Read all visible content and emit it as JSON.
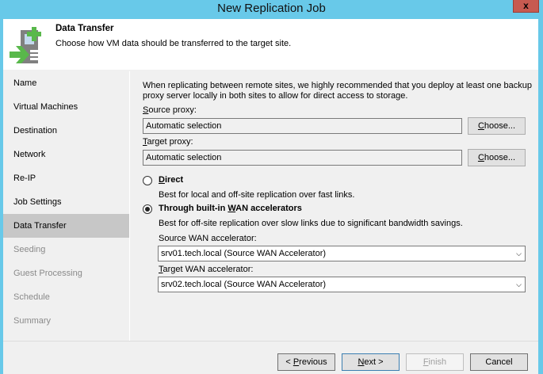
{
  "window": {
    "title": "New Replication Job",
    "close_label": "x"
  },
  "header": {
    "title": "Data Transfer",
    "subtitle": "Choose how VM data should be transferred to the target site."
  },
  "sidebar": {
    "items": [
      {
        "label": "Name",
        "state": "normal"
      },
      {
        "label": "Virtual Machines",
        "state": "normal"
      },
      {
        "label": "Destination",
        "state": "normal"
      },
      {
        "label": "Network",
        "state": "normal"
      },
      {
        "label": "Re-IP",
        "state": "normal"
      },
      {
        "label": "Job Settings",
        "state": "normal"
      },
      {
        "label": "Data Transfer",
        "state": "active"
      },
      {
        "label": "Seeding",
        "state": "disabled"
      },
      {
        "label": "Guest Processing",
        "state": "disabled"
      },
      {
        "label": "Schedule",
        "state": "disabled"
      },
      {
        "label": "Summary",
        "state": "disabled"
      }
    ]
  },
  "main": {
    "info_line1": "When replicating between remote sites, we highly recommended that you deploy at least one backup",
    "info_line2": "proxy server locally in both sites to allow for direct access to storage.",
    "source_proxy": {
      "label_u": "S",
      "label_rest": "ource proxy:",
      "value": "Automatic selection",
      "button_u": "C",
      "button_rest": "hoose..."
    },
    "target_proxy": {
      "label_u": "T",
      "label_rest": "arget proxy:",
      "value": "Automatic selection",
      "button_u": "C",
      "button_rest": "hoose..."
    },
    "direct": {
      "label_u": "D",
      "label_rest": "irect",
      "desc": "Best for local and off-site replication over fast links.",
      "selected": false
    },
    "wan": {
      "label_pre": "Through built-in ",
      "label_u": "W",
      "label_rest": "AN accelerators",
      "desc": "Best for off-site replication over slow links due to significant bandwidth savings.",
      "selected": true
    },
    "source_wan": {
      "label": "Source WAN accelerator:",
      "value": "srv01.tech.local (Source WAN Accelerator)"
    },
    "target_wan": {
      "label_u": "T",
      "label_rest": "arget WAN accelerator:",
      "value": "srv02.tech.local (Source WAN Accelerator)"
    }
  },
  "footer": {
    "previous_pre": "< ",
    "previous_u": "P",
    "previous_rest": "revious",
    "next_u": "N",
    "next_rest": "ext >",
    "finish_u": "F",
    "finish_rest": "inish",
    "cancel": "Cancel"
  }
}
